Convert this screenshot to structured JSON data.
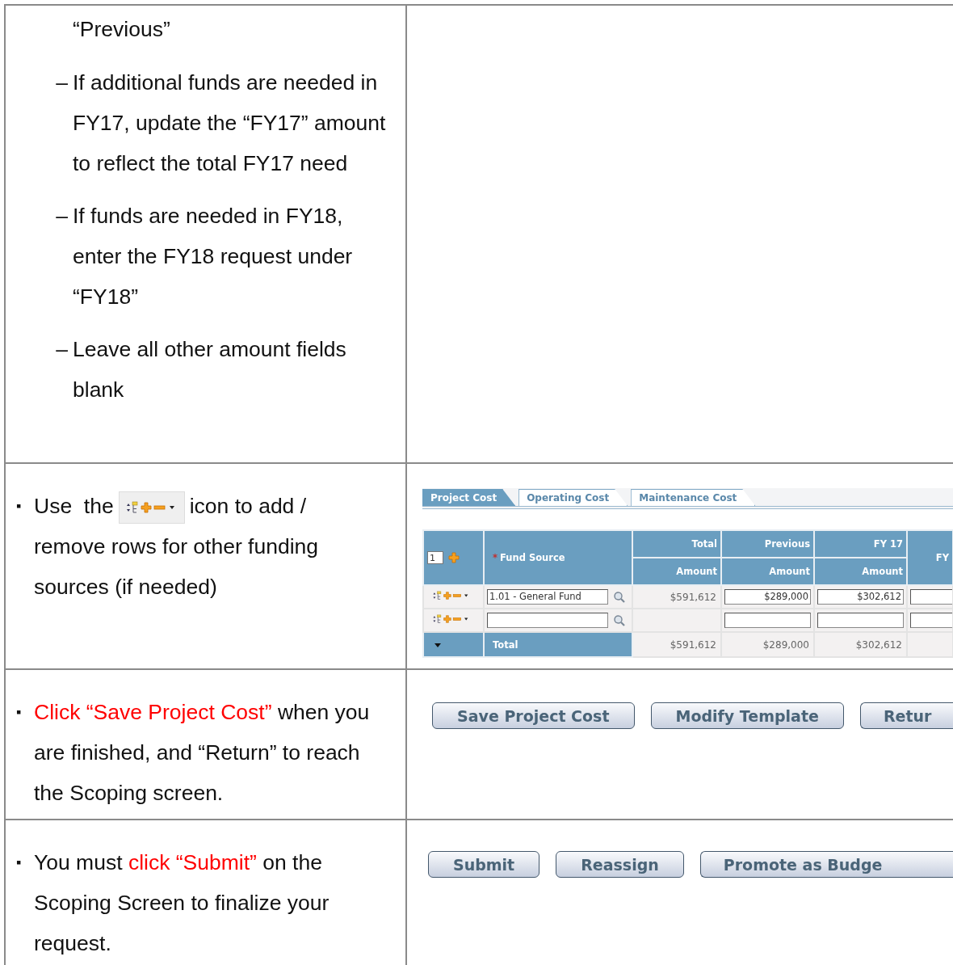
{
  "rows": [
    {
      "instruction": {
        "kind": "notes",
        "lines": [
          {
            "kind": "continuation",
            "text": "“Previous”"
          },
          {
            "kind": "dash",
            "marker": "–",
            "text": "If additional funds are needed in FY17, update the “FY17” amount to reflect the total FY17 need"
          },
          {
            "kind": "dash",
            "marker": "–",
            "text": "If funds are needed in FY18, enter the FY18 request under “FY18”"
          },
          {
            "kind": "dash",
            "marker": "–",
            "text": "Leave all other amount fields blank"
          }
        ]
      }
    },
    {
      "instruction": {
        "kind": "bullet",
        "marker": "▪",
        "segments": [
          {
            "kind": "text",
            "text": "Use  the",
            "highlight": false
          },
          {
            "kind": "icon"
          },
          {
            "kind": "text",
            "text": "icon to add /",
            "highlight": false
          },
          {
            "kind": "line",
            "text": "remove rows for other funding sources (if needed)",
            "highlight": false
          }
        ]
      },
      "panel": {
        "kind": "cost-table",
        "tabs": [
          {
            "label": "Project Cost",
            "selected": true
          },
          {
            "label": "Operating Cost",
            "selected": false
          },
          {
            "label": "Maintenance Cost",
            "selected": false
          }
        ],
        "row_count": "1",
        "required_mark": "*",
        "source_header": "Fund Source",
        "columns": [
          {
            "top": "Total",
            "bottom": "Amount"
          },
          {
            "top": "Previous",
            "bottom": "Amount"
          },
          {
            "top": "FY 17",
            "bottom": "Amount"
          },
          {
            "top": "FY"
          }
        ],
        "rows": [
          {
            "source": "1.01 - General Fund",
            "total": "$591,612",
            "amounts": [
              "$289,000",
              "$302,612"
            ]
          },
          {
            "amounts": []
          }
        ],
        "total_row": {
          "label": "Total",
          "values": [
            "$591,612",
            "$289,000",
            "$302,612"
          ]
        }
      }
    },
    {
      "instruction": {
        "kind": "bullet",
        "marker": "▪",
        "segments": [
          {
            "kind": "text",
            "text": "Click “Save Project Cost”",
            "highlight": true
          },
          {
            "kind": "text",
            "text": " when you are finished, and “Return” to reach the Scoping screen.",
            "highlight": false
          }
        ]
      },
      "panel": {
        "kind": "buttons",
        "buttons": [
          {
            "label": "Save Project Cost"
          },
          {
            "label": "Modify Template"
          },
          {
            "label": "Retur"
          }
        ]
      }
    },
    {
      "instruction": {
        "kind": "bullet",
        "marker": "▪",
        "segments": [
          {
            "kind": "text",
            "text": "You must ",
            "highlight": false
          },
          {
            "kind": "text",
            "text": "click “Submit”",
            "highlight": true
          },
          {
            "kind": "text",
            "text": " on the Scoping Screen to finalize your request.",
            "highlight": false
          }
        ]
      },
      "panel": {
        "kind": "buttons",
        "buttons": [
          {
            "label": "Submit"
          },
          {
            "label": "Reassign"
          },
          {
            "label": "Promote as Budge"
          }
        ]
      }
    }
  ]
}
